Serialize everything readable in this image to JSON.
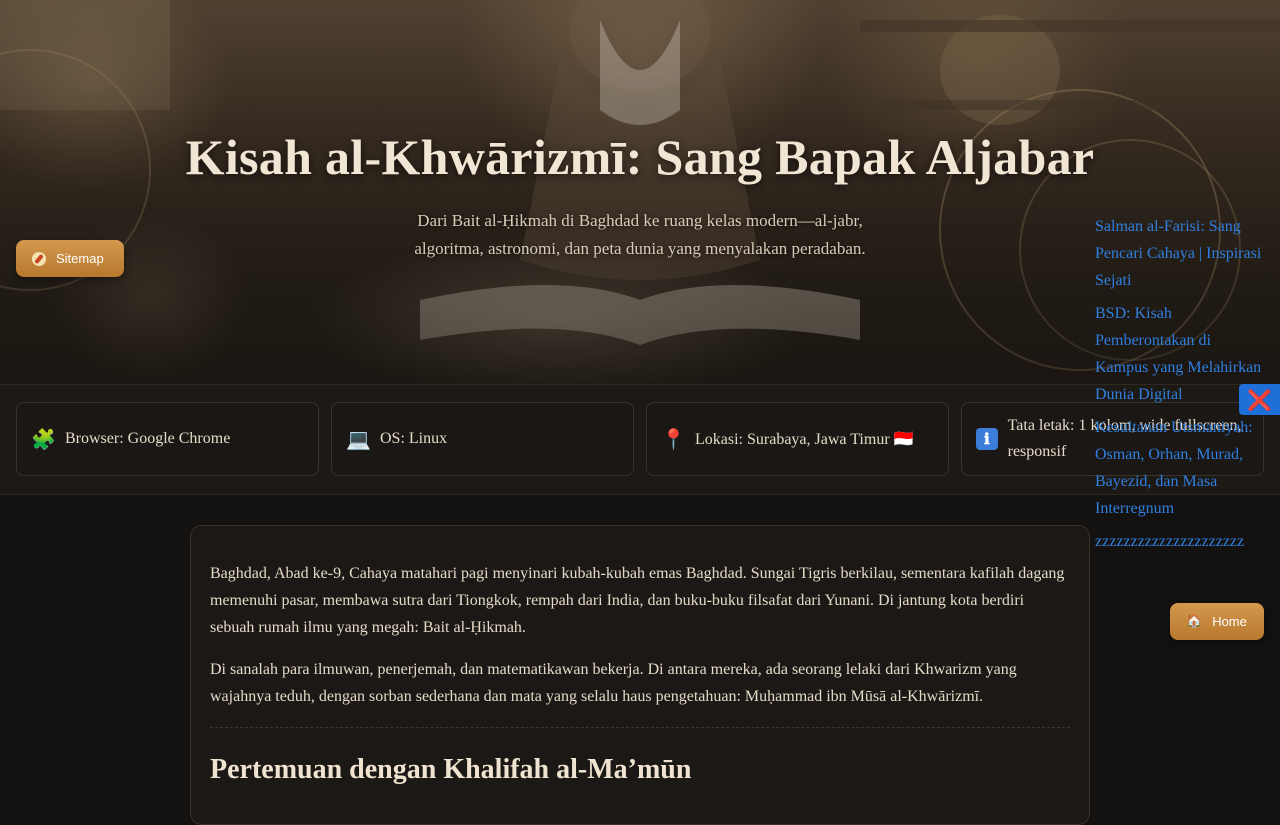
{
  "hero": {
    "title": "Kisah al-Khwārizmī: Sang Bapak Aljabar",
    "subtitle": "Dari Bait al-Ḥikmah di Baghdad ke ruang kelas modern—al-jabr, algoritma, astronomi, dan peta dunia yang menyalakan peradaban."
  },
  "buttons": {
    "sitemap_label": "Sitemap",
    "home_label": "Home",
    "home_icon": "🏠",
    "close_icon": "❌"
  },
  "info": [
    {
      "icon": "🧩",
      "text": "Browser: Google Chrome"
    },
    {
      "icon": "💻",
      "text": "OS: Linux"
    },
    {
      "icon": "📍",
      "text": "Lokasi: Surabaya, Jawa Timur 🇮🇩"
    },
    {
      "icon": "ℹ",
      "text": "Tata letak: 1 kolom, wide fullscreen, responsif"
    }
  ],
  "article": {
    "p1": "Baghdad, Abad ke-9, Cahaya matahari pagi menyinari kubah-kubah emas Baghdad. Sungai Tigris berkilau, sementara kafilah dagang memenuhi pasar, membawa sutra dari Tiongkok, rempah dari India, dan buku-buku filsafat dari Yunani. Di jantung kota berdiri sebuah rumah ilmu yang megah: Bait al-Ḥikmah.",
    "p2": "Di sanalah para ilmuwan, penerjemah, dan matematikawan bekerja. Di antara mereka, ada seorang lelaki dari Khwarizm yang wajahnya teduh, dengan sorban sederhana dan mata yang selalu haus pengetahuan: Muḥammad ibn Mūsā al-Khwārizmī.",
    "h2": "Pertemuan dengan Khalifah al-Ma’mūn"
  },
  "sidelinks": [
    "Salman al-Farisi: Sang Pencari Cahaya | Inspirasi Sejati",
    "BSD: Kisah Pemberontakan di Kampus yang Melahirkan Dunia Digital",
    "Kesultanan Utsmaniyah: Osman, Orhan, Murad, Bayezid, dan Masa Interregnum",
    "zzzzzzzzzzzzzzzzzzzzz"
  ]
}
